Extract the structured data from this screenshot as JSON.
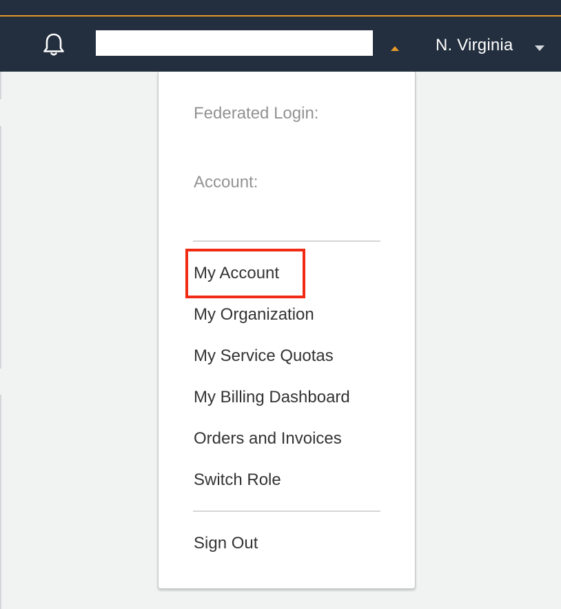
{
  "navbar": {
    "bell_icon": "bell-icon",
    "account_caret_icon": "caret-up-icon",
    "account_caret_color": "#e79a2a",
    "region": "N. Virginia",
    "region_caret_icon": "caret-down-icon",
    "bar_color": "#232f3e",
    "accent_color": "#e79a2a"
  },
  "dropdown": {
    "info": {
      "federated_login": "Federated Login:",
      "account": "Account:"
    },
    "items": [
      {
        "label": "My Account"
      },
      {
        "label": "My Organization"
      },
      {
        "label": "My Service Quotas"
      },
      {
        "label": "My Billing Dashboard"
      },
      {
        "label": "Orders and Invoices"
      },
      {
        "label": "Switch Role"
      }
    ],
    "sign_out": "Sign Out"
  },
  "annotation": {
    "highlight_color": "#f12b13",
    "highlighted_item": "My Account"
  }
}
